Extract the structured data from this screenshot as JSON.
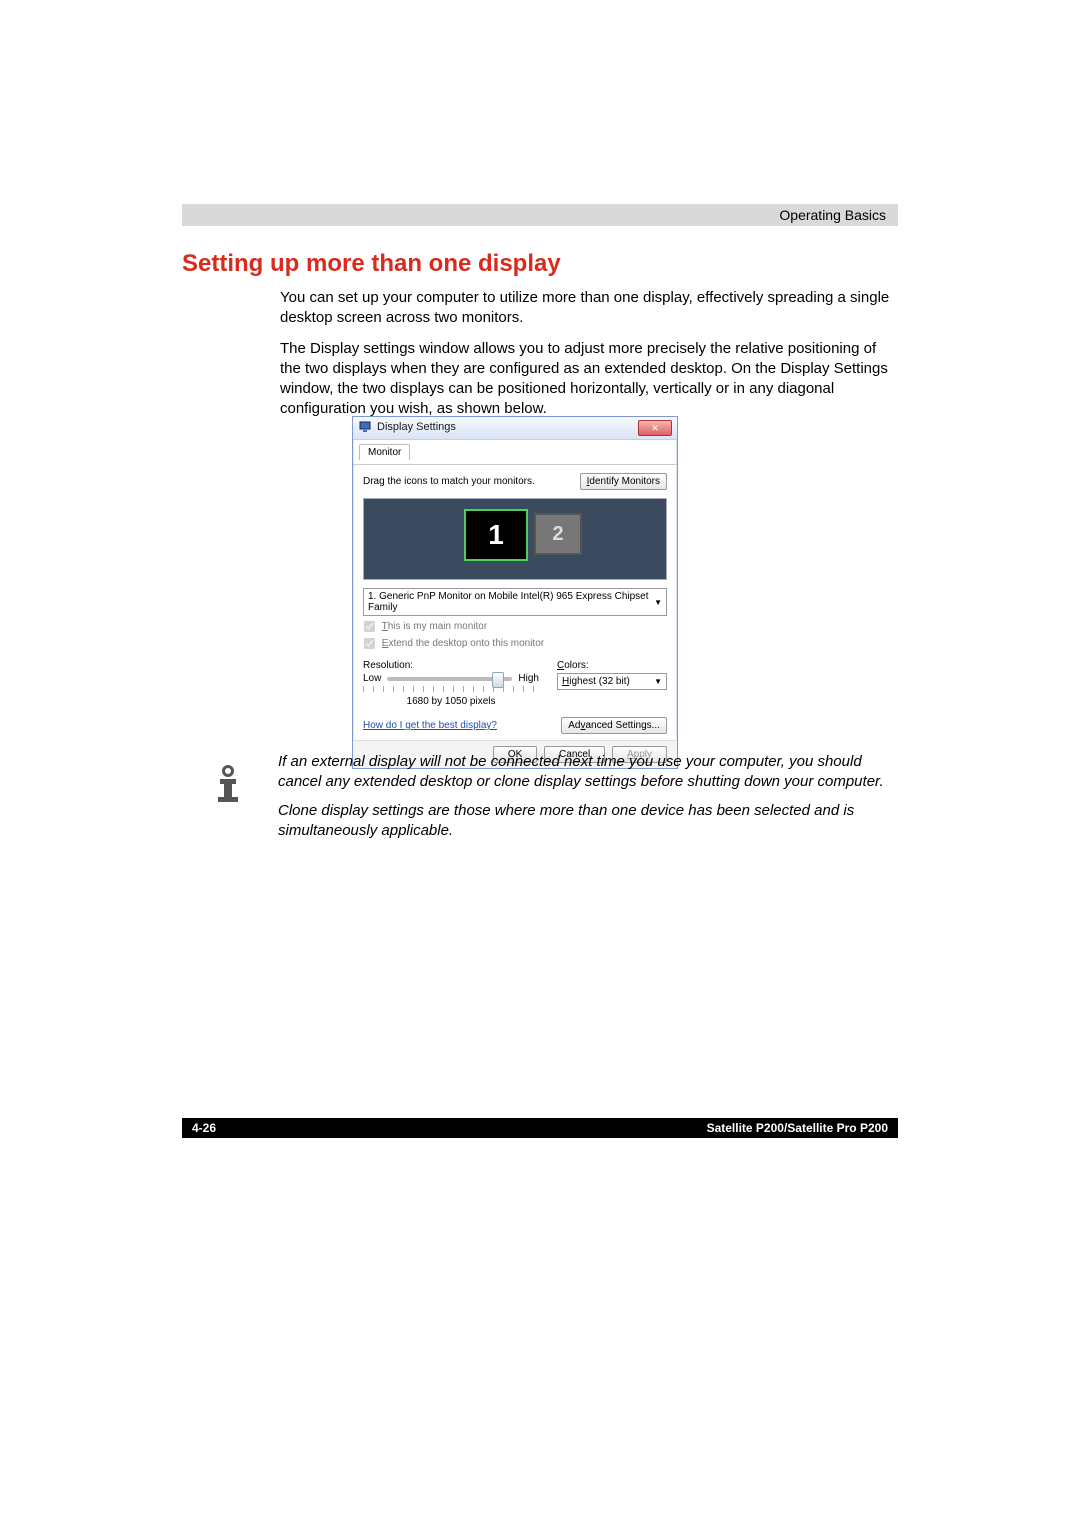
{
  "header": {
    "section": "Operating Basics"
  },
  "title": "Setting up more than one display",
  "body": {
    "p1": "You can set up your computer to utilize more than one display, effectively spreading a single desktop screen across two monitors.",
    "p2": "The Display settings window allows you to adjust more precisely the relative positioning of the two displays when they are configured as an extended desktop. On the Display Settings window, the two displays can be positioned horizontally, vertically or in any diagonal configuration you wish, as shown below."
  },
  "dialog": {
    "title": "Display Settings",
    "tab": "Monitor",
    "drag_text": "Drag the icons to match your monitors.",
    "identify_btn": "Identify Monitors",
    "monitor1": "1",
    "monitor2": "2",
    "monitor_select": "1. Generic PnP Monitor on Mobile Intel(R) 965 Express Chipset Family",
    "check_main": "This is my main monitor",
    "check_extend": "Extend the desktop onto this monitor",
    "resolution_label": "Resolution:",
    "low": "Low",
    "high": "High",
    "resolution_value": "1680 by 1050 pixels",
    "colors_label": "Colors:",
    "colors_value": "Highest (32 bit)",
    "help_link": "How do I get the best display?",
    "advanced_btn": "Advanced Settings...",
    "ok": "OK",
    "cancel": "Cancel",
    "apply": "Apply"
  },
  "note": {
    "p1": "If an external display will not be connected next time you use your computer, you should cancel any extended desktop or clone display settings before shutting down your computer.",
    "p2": "Clone display settings are those where more than one device has been selected and is simultaneously applicable."
  },
  "footer": {
    "page": "4-26",
    "model": "Satellite P200/Satellite Pro P200"
  }
}
